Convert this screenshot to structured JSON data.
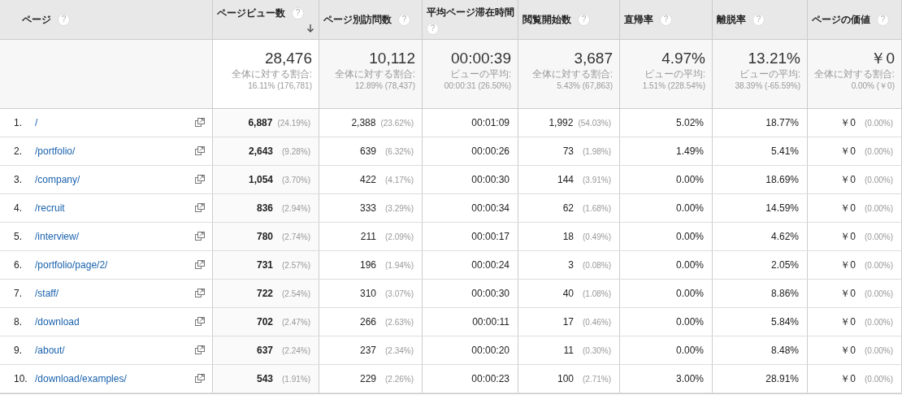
{
  "columns": [
    {
      "label": "ページ",
      "help": "?",
      "sorted": false
    },
    {
      "label": "ページビュー数",
      "help": "?",
      "sorted": true
    },
    {
      "label": "ページ別訪問数",
      "help": "?",
      "sorted": false
    },
    {
      "label": "平均ページ滞在時間",
      "help": "?",
      "sorted": false
    },
    {
      "label": "閲覧開始数",
      "help": "?",
      "sorted": false
    },
    {
      "label": "直帰率",
      "help": "?",
      "sorted": false
    },
    {
      "label": "離脱率",
      "help": "?",
      "sorted": false
    },
    {
      "label": "ページの価値",
      "help": "?",
      "sorted": false
    }
  ],
  "totals": [
    {
      "value": "28,476",
      "caption": "全体に対する割合:",
      "detail": "16.11% (176,781)"
    },
    {
      "value": "10,112",
      "caption": "全体に対する割合:",
      "detail": "12.89% (78,437)"
    },
    {
      "value": "00:00:39",
      "caption": "ビューの平均:",
      "detail": "00:00:31 (26.50%)"
    },
    {
      "value": "3,687",
      "caption": "全体に対する割合:",
      "detail": "5.43% (67,863)"
    },
    {
      "value": "4.97%",
      "caption": "ビューの平均:",
      "detail": "1.51% (228.54%)"
    },
    {
      "value": "13.21%",
      "caption": "ビューの平均:",
      "detail": "38.39% (-65.59%)"
    },
    {
      "value": "￥0",
      "caption": "全体に対する割合:",
      "detail": "0.00% (￥0)"
    }
  ],
  "rows": [
    {
      "rank": "1.",
      "page": "/",
      "cells": [
        {
          "value": "6,887",
          "share": "(24.19%)"
        },
        {
          "value": "2,388",
          "share": "(23.62%)"
        },
        {
          "value": "00:01:09"
        },
        {
          "value": "1,992",
          "share": "(54.03%)"
        },
        {
          "value": "5.02%"
        },
        {
          "value": "18.77%"
        },
        {
          "value": "￥0",
          "share": "(0.00%)"
        }
      ]
    },
    {
      "rank": "2.",
      "page": "/portfolio/",
      "cells": [
        {
          "value": "2,643",
          "share": "(9.28%)"
        },
        {
          "value": "639",
          "share": "(6.32%)"
        },
        {
          "value": "00:00:26"
        },
        {
          "value": "73",
          "share": "(1.98%)"
        },
        {
          "value": "1.49%"
        },
        {
          "value": "5.41%"
        },
        {
          "value": "￥0",
          "share": "(0.00%)"
        }
      ]
    },
    {
      "rank": "3.",
      "page": "/company/",
      "cells": [
        {
          "value": "1,054",
          "share": "(3.70%)"
        },
        {
          "value": "422",
          "share": "(4.17%)"
        },
        {
          "value": "00:00:30"
        },
        {
          "value": "144",
          "share": "(3.91%)"
        },
        {
          "value": "0.00%"
        },
        {
          "value": "18.69%"
        },
        {
          "value": "￥0",
          "share": "(0.00%)"
        }
      ]
    },
    {
      "rank": "4.",
      "page": "/recruit",
      "cells": [
        {
          "value": "836",
          "share": "(2.94%)"
        },
        {
          "value": "333",
          "share": "(3.29%)"
        },
        {
          "value": "00:00:34"
        },
        {
          "value": "62",
          "share": "(1.68%)"
        },
        {
          "value": "0.00%"
        },
        {
          "value": "14.59%"
        },
        {
          "value": "￥0",
          "share": "(0.00%)"
        }
      ]
    },
    {
      "rank": "5.",
      "page": "/interview/",
      "cells": [
        {
          "value": "780",
          "share": "(2.74%)"
        },
        {
          "value": "211",
          "share": "(2.09%)"
        },
        {
          "value": "00:00:17"
        },
        {
          "value": "18",
          "share": "(0.49%)"
        },
        {
          "value": "0.00%"
        },
        {
          "value": "4.62%"
        },
        {
          "value": "￥0",
          "share": "(0.00%)"
        }
      ]
    },
    {
      "rank": "6.",
      "page": "/portfolio/page/2/",
      "cells": [
        {
          "value": "731",
          "share": "(2.57%)"
        },
        {
          "value": "196",
          "share": "(1.94%)"
        },
        {
          "value": "00:00:24"
        },
        {
          "value": "3",
          "share": "(0.08%)"
        },
        {
          "value": "0.00%"
        },
        {
          "value": "2.05%"
        },
        {
          "value": "￥0",
          "share": "(0.00%)"
        }
      ]
    },
    {
      "rank": "7.",
      "page": "/staff/",
      "cells": [
        {
          "value": "722",
          "share": "(2.54%)"
        },
        {
          "value": "310",
          "share": "(3.07%)"
        },
        {
          "value": "00:00:30"
        },
        {
          "value": "40",
          "share": "(1.08%)"
        },
        {
          "value": "0.00%"
        },
        {
          "value": "8.86%"
        },
        {
          "value": "￥0",
          "share": "(0.00%)"
        }
      ]
    },
    {
      "rank": "8.",
      "page": "/download",
      "cells": [
        {
          "value": "702",
          "share": "(2.47%)"
        },
        {
          "value": "266",
          "share": "(2.63%)"
        },
        {
          "value": "00:00:11"
        },
        {
          "value": "17",
          "share": "(0.46%)"
        },
        {
          "value": "0.00%"
        },
        {
          "value": "5.84%"
        },
        {
          "value": "￥0",
          "share": "(0.00%)"
        }
      ]
    },
    {
      "rank": "9.",
      "page": "/about/",
      "cells": [
        {
          "value": "637",
          "share": "(2.24%)"
        },
        {
          "value": "237",
          "share": "(2.34%)"
        },
        {
          "value": "00:00:20"
        },
        {
          "value": "11",
          "share": "(0.30%)"
        },
        {
          "value": "0.00%"
        },
        {
          "value": "8.48%"
        },
        {
          "value": "￥0",
          "share": "(0.00%)"
        }
      ]
    },
    {
      "rank": "10.",
      "page": "/download/examples/",
      "cells": [
        {
          "value": "543",
          "share": "(1.91%)"
        },
        {
          "value": "229",
          "share": "(2.26%)"
        },
        {
          "value": "00:00:23"
        },
        {
          "value": "100",
          "share": "(2.71%)"
        },
        {
          "value": "3.00%"
        },
        {
          "value": "28.91%"
        },
        {
          "value": "￥0",
          "share": "(0.00%)"
        }
      ]
    }
  ]
}
